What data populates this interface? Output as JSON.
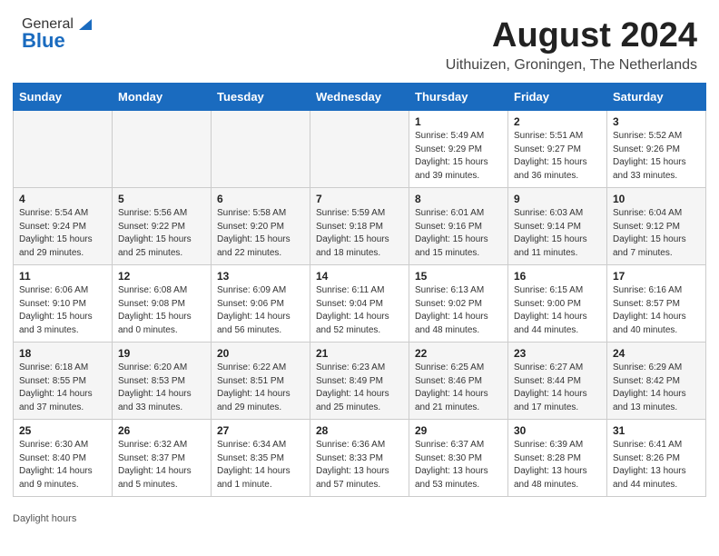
{
  "header": {
    "logo_general": "General",
    "logo_blue": "Blue",
    "month_title": "August 2024",
    "location": "Uithuizen, Groningen, The Netherlands"
  },
  "days_of_week": [
    "Sunday",
    "Monday",
    "Tuesday",
    "Wednesday",
    "Thursday",
    "Friday",
    "Saturday"
  ],
  "footer": {
    "daylight_label": "Daylight hours"
  },
  "weeks": [
    [
      {
        "day": "",
        "info": ""
      },
      {
        "day": "",
        "info": ""
      },
      {
        "day": "",
        "info": ""
      },
      {
        "day": "",
        "info": ""
      },
      {
        "day": "1",
        "info": "Sunrise: 5:49 AM\nSunset: 9:29 PM\nDaylight: 15 hours\nand 39 minutes."
      },
      {
        "day": "2",
        "info": "Sunrise: 5:51 AM\nSunset: 9:27 PM\nDaylight: 15 hours\nand 36 minutes."
      },
      {
        "day": "3",
        "info": "Sunrise: 5:52 AM\nSunset: 9:26 PM\nDaylight: 15 hours\nand 33 minutes."
      }
    ],
    [
      {
        "day": "4",
        "info": "Sunrise: 5:54 AM\nSunset: 9:24 PM\nDaylight: 15 hours\nand 29 minutes."
      },
      {
        "day": "5",
        "info": "Sunrise: 5:56 AM\nSunset: 9:22 PM\nDaylight: 15 hours\nand 25 minutes."
      },
      {
        "day": "6",
        "info": "Sunrise: 5:58 AM\nSunset: 9:20 PM\nDaylight: 15 hours\nand 22 minutes."
      },
      {
        "day": "7",
        "info": "Sunrise: 5:59 AM\nSunset: 9:18 PM\nDaylight: 15 hours\nand 18 minutes."
      },
      {
        "day": "8",
        "info": "Sunrise: 6:01 AM\nSunset: 9:16 PM\nDaylight: 15 hours\nand 15 minutes."
      },
      {
        "day": "9",
        "info": "Sunrise: 6:03 AM\nSunset: 9:14 PM\nDaylight: 15 hours\nand 11 minutes."
      },
      {
        "day": "10",
        "info": "Sunrise: 6:04 AM\nSunset: 9:12 PM\nDaylight: 15 hours\nand 7 minutes."
      }
    ],
    [
      {
        "day": "11",
        "info": "Sunrise: 6:06 AM\nSunset: 9:10 PM\nDaylight: 15 hours\nand 3 minutes."
      },
      {
        "day": "12",
        "info": "Sunrise: 6:08 AM\nSunset: 9:08 PM\nDaylight: 15 hours\nand 0 minutes."
      },
      {
        "day": "13",
        "info": "Sunrise: 6:09 AM\nSunset: 9:06 PM\nDaylight: 14 hours\nand 56 minutes."
      },
      {
        "day": "14",
        "info": "Sunrise: 6:11 AM\nSunset: 9:04 PM\nDaylight: 14 hours\nand 52 minutes."
      },
      {
        "day": "15",
        "info": "Sunrise: 6:13 AM\nSunset: 9:02 PM\nDaylight: 14 hours\nand 48 minutes."
      },
      {
        "day": "16",
        "info": "Sunrise: 6:15 AM\nSunset: 9:00 PM\nDaylight: 14 hours\nand 44 minutes."
      },
      {
        "day": "17",
        "info": "Sunrise: 6:16 AM\nSunset: 8:57 PM\nDaylight: 14 hours\nand 40 minutes."
      }
    ],
    [
      {
        "day": "18",
        "info": "Sunrise: 6:18 AM\nSunset: 8:55 PM\nDaylight: 14 hours\nand 37 minutes."
      },
      {
        "day": "19",
        "info": "Sunrise: 6:20 AM\nSunset: 8:53 PM\nDaylight: 14 hours\nand 33 minutes."
      },
      {
        "day": "20",
        "info": "Sunrise: 6:22 AM\nSunset: 8:51 PM\nDaylight: 14 hours\nand 29 minutes."
      },
      {
        "day": "21",
        "info": "Sunrise: 6:23 AM\nSunset: 8:49 PM\nDaylight: 14 hours\nand 25 minutes."
      },
      {
        "day": "22",
        "info": "Sunrise: 6:25 AM\nSunset: 8:46 PM\nDaylight: 14 hours\nand 21 minutes."
      },
      {
        "day": "23",
        "info": "Sunrise: 6:27 AM\nSunset: 8:44 PM\nDaylight: 14 hours\nand 17 minutes."
      },
      {
        "day": "24",
        "info": "Sunrise: 6:29 AM\nSunset: 8:42 PM\nDaylight: 14 hours\nand 13 minutes."
      }
    ],
    [
      {
        "day": "25",
        "info": "Sunrise: 6:30 AM\nSunset: 8:40 PM\nDaylight: 14 hours\nand 9 minutes."
      },
      {
        "day": "26",
        "info": "Sunrise: 6:32 AM\nSunset: 8:37 PM\nDaylight: 14 hours\nand 5 minutes."
      },
      {
        "day": "27",
        "info": "Sunrise: 6:34 AM\nSunset: 8:35 PM\nDaylight: 14 hours\nand 1 minute."
      },
      {
        "day": "28",
        "info": "Sunrise: 6:36 AM\nSunset: 8:33 PM\nDaylight: 13 hours\nand 57 minutes."
      },
      {
        "day": "29",
        "info": "Sunrise: 6:37 AM\nSunset: 8:30 PM\nDaylight: 13 hours\nand 53 minutes."
      },
      {
        "day": "30",
        "info": "Sunrise: 6:39 AM\nSunset: 8:28 PM\nDaylight: 13 hours\nand 48 minutes."
      },
      {
        "day": "31",
        "info": "Sunrise: 6:41 AM\nSunset: 8:26 PM\nDaylight: 13 hours\nand 44 minutes."
      }
    ]
  ]
}
